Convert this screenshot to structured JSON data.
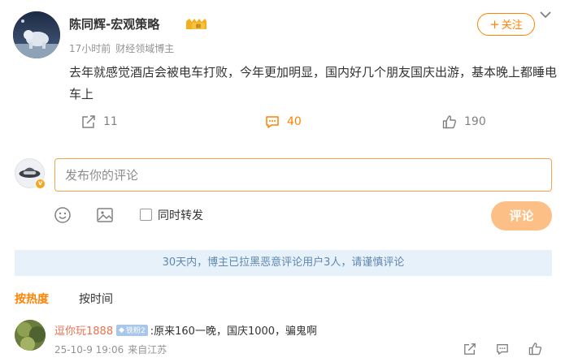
{
  "post": {
    "author": "陈同辉-宏观策略",
    "vip_badge_text": "III",
    "time": "17小时前",
    "verification": "财经领域博主",
    "follow_label": "关注",
    "follow_plus": "+",
    "content": "去年就感觉酒店会被电车打败，今年更加明显，国内好几个朋友国庆出游，基本晚上都睡电车上",
    "actions": {
      "repost_count": "11",
      "comment_count": "40",
      "like_count": "190"
    }
  },
  "composer": {
    "placeholder": "发布你的评论",
    "repost_label": "同时转发",
    "submit_label": "评论"
  },
  "notice": "30天内，博主已拉黑恶意评论用户3人，请谨慎评论",
  "sort_tabs": {
    "hot": "按热度",
    "time": "按时间"
  },
  "comments": [
    {
      "user": "逗你玩1888",
      "fan_badge": "铁粉2",
      "text": ":原来160一晚，国庆1000，骗鬼啊",
      "date": "25-10-9 19:06",
      "location": "来自江苏"
    }
  ],
  "colors": {
    "accent": "#ff8200",
    "notice_bg": "#e7f1fa",
    "notice_text": "#5f87b0",
    "username": "#eb7350"
  },
  "icons": [
    "repost-icon",
    "comment-icon",
    "like-icon",
    "emoji-icon",
    "image-icon",
    "chevron-down-icon"
  ]
}
